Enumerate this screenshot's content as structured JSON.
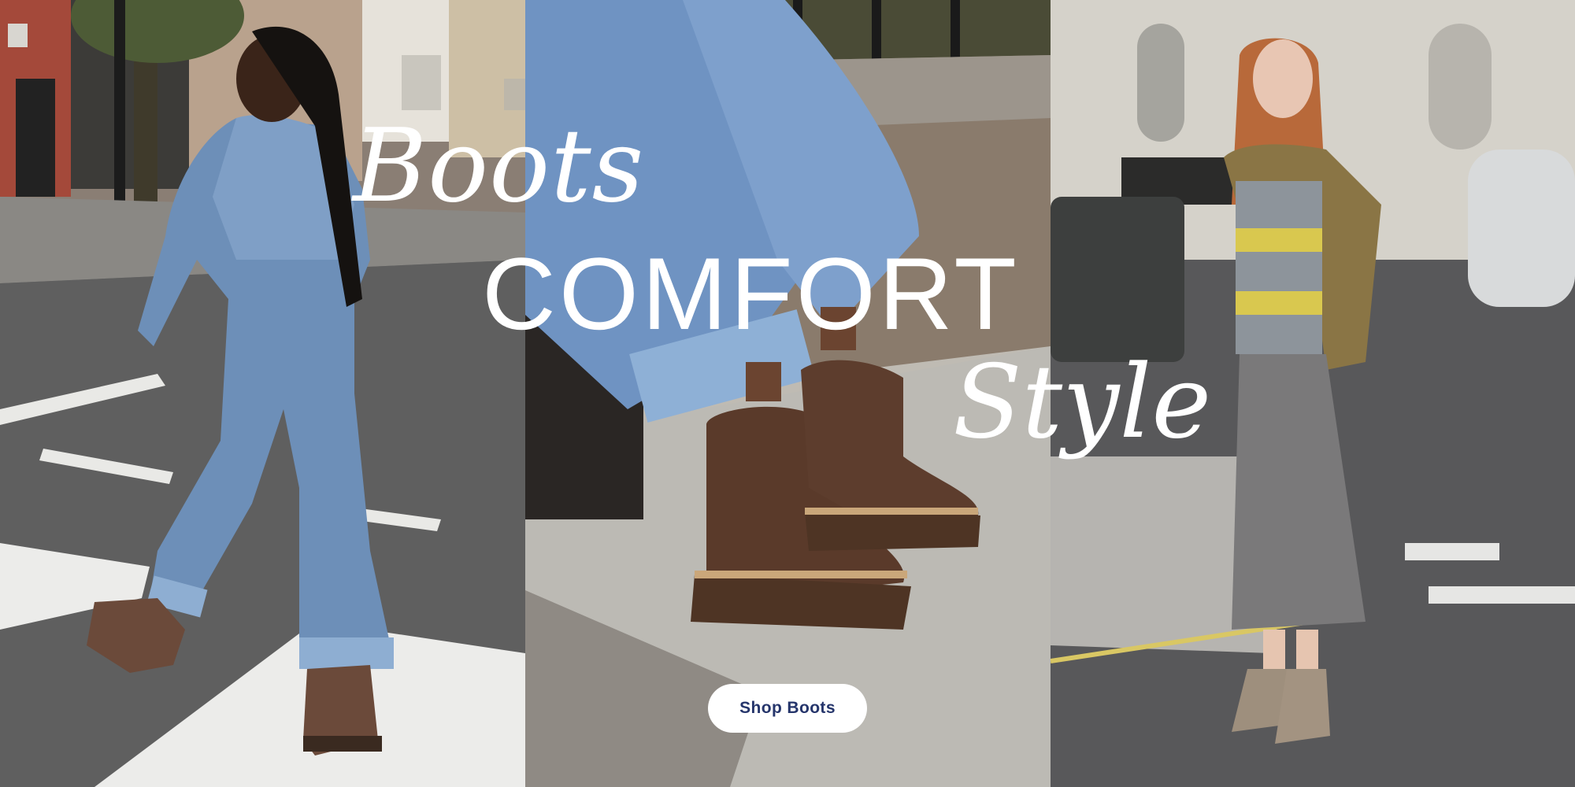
{
  "hero": {
    "headline_line1": "Boots",
    "headline_line2": "COMFORT",
    "headline_line3": "Style",
    "cta_label": "Shop Boots",
    "colors": {
      "headline": "#ffffff",
      "cta_background": "#ffffff",
      "cta_text": "#25356b"
    }
  },
  "panels": [
    {
      "name": "left",
      "alt": "woman-in-denim-walking-in-chelsea-boots"
    },
    {
      "name": "center",
      "alt": "brown-chelsea-boots-close-up"
    },
    {
      "name": "right",
      "alt": "woman-in-striped-sweater-and-taupe-boots"
    }
  ]
}
